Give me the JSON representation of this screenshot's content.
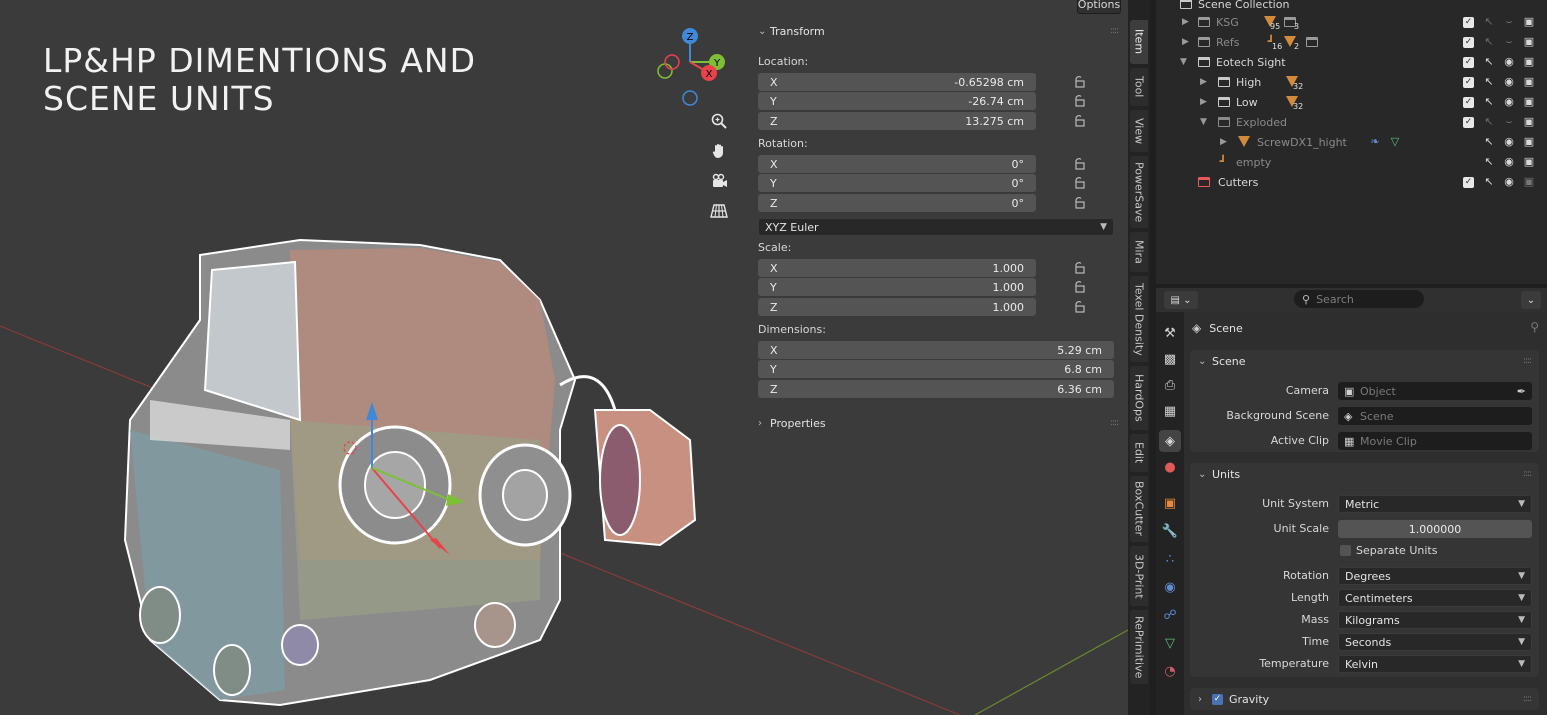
{
  "viewport": {
    "title": "LP&HP DIMENTIONS AND\nSCENE UNITS",
    "options_label": "Options",
    "gizmo": {
      "z": "Z",
      "y": "Y",
      "x": "X"
    }
  },
  "npanel": {
    "transform_header": "Transform",
    "location_label": "Location:",
    "location": [
      {
        "axis": "X",
        "value": "-0.65298 cm"
      },
      {
        "axis": "Y",
        "value": "-26.74 cm"
      },
      {
        "axis": "Z",
        "value": "13.275 cm"
      }
    ],
    "rotation_label": "Rotation:",
    "rotation": [
      {
        "axis": "X",
        "value": "0°"
      },
      {
        "axis": "Y",
        "value": "0°"
      },
      {
        "axis": "Z",
        "value": "0°"
      }
    ],
    "rotation_mode": "XYZ Euler",
    "scale_label": "Scale:",
    "scale": [
      {
        "axis": "X",
        "value": "1.000"
      },
      {
        "axis": "Y",
        "value": "1.000"
      },
      {
        "axis": "Z",
        "value": "1.000"
      }
    ],
    "dimensions_label": "Dimensions:",
    "dimensions": [
      {
        "axis": "X",
        "value": "5.29 cm"
      },
      {
        "axis": "Y",
        "value": "6.8 cm"
      },
      {
        "axis": "Z",
        "value": "6.36 cm"
      }
    ],
    "properties_header": "Properties"
  },
  "vtabs": [
    "Item",
    "Tool",
    "View",
    "PowerSave",
    "Mira",
    "Texel Density",
    "HardOps",
    "Edit",
    "BoxCutter",
    "3D-Print",
    "RePrimitive"
  ],
  "outliner": {
    "root": "Scene Collection",
    "rows": [
      {
        "name": "KSG",
        "b1": "95",
        "b2": "3"
      },
      {
        "name": "Refs",
        "b1": "16",
        "b2": "2"
      },
      {
        "name": "Eotech Sight"
      },
      {
        "name": "High",
        "b1": "32"
      },
      {
        "name": "Low",
        "b1": "32"
      },
      {
        "name": "Exploded"
      },
      {
        "name": "ScrewDX1_hight"
      },
      {
        "name": "empty"
      },
      {
        "name": "Cutters"
      }
    ]
  },
  "props": {
    "search_placeholder": "Search",
    "context": "Scene",
    "scene_panel": "Scene",
    "camera_label": "Camera",
    "camera_placeholder": "Object",
    "bg_scene_label": "Background Scene",
    "bg_scene_placeholder": "Scene",
    "active_clip_label": "Active Clip",
    "active_clip_placeholder": "Movie Clip",
    "units_panel": "Units",
    "unit_system_label": "Unit System",
    "unit_system": "Metric",
    "unit_scale_label": "Unit Scale",
    "unit_scale": "1.000000",
    "separate_units_label": "Separate Units",
    "rotation_label": "Rotation",
    "rotation": "Degrees",
    "length_label": "Length",
    "length": "Centimeters",
    "mass_label": "Mass",
    "mass": "Kilograms",
    "time_label": "Time",
    "time": "Seconds",
    "temperature_label": "Temperature",
    "temperature": "Kelvin",
    "gravity_label": "Gravity"
  },
  "colors": {
    "accent": "#4772b3",
    "x_axis": "#e8434a",
    "y_axis": "#7ec034",
    "z_axis": "#3f89d8",
    "collection_red": "#e85a5a",
    "mesh_orange": "#d38a3d"
  }
}
